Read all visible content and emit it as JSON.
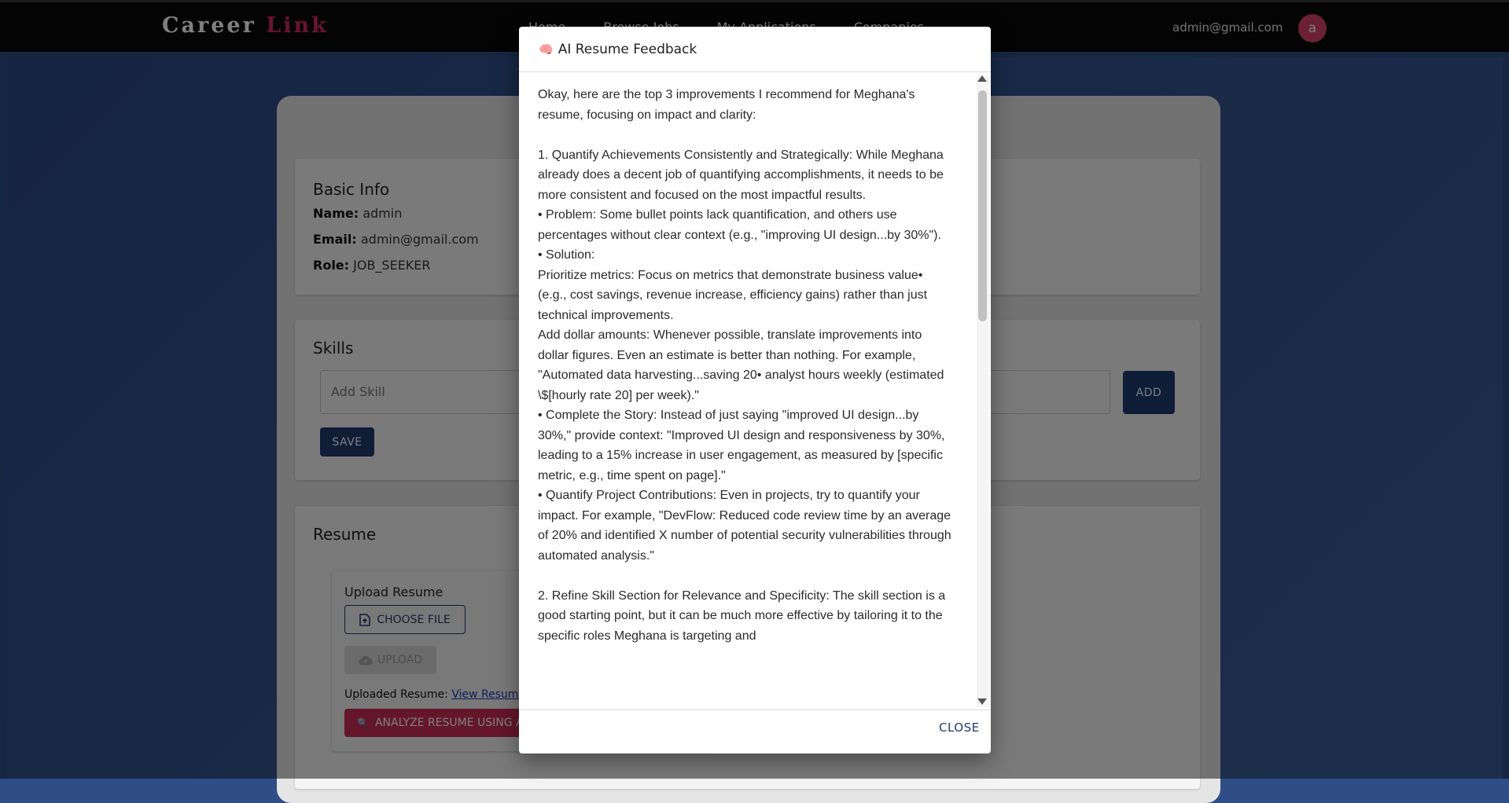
{
  "header": {
    "brand_part1": "Career",
    "brand_part2": "Link",
    "nav": [
      "Home",
      "Browse Jobs",
      "My Applications",
      "Companies"
    ],
    "user_email": "admin@gmail.com",
    "avatar_initial": "a"
  },
  "basic_info": {
    "title": "Basic Info",
    "name_label": "Name:",
    "name_value": "admin",
    "email_label": "Email:",
    "email_value": "admin@gmail.com",
    "role_label": "Role:",
    "role_value": "JOB_SEEKER"
  },
  "skills": {
    "title": "Skills",
    "placeholder": "Add Skill",
    "add_label": "ADD",
    "save_label": "SAVE"
  },
  "resume": {
    "title": "Resume",
    "upload_title": "Upload Resume",
    "choose_label": "CHOOSE FILE",
    "upload_label": "UPLOAD",
    "uploaded_prefix": "Uploaded Resume:",
    "view_link": "View Resume",
    "analyze_label": "ANALYZE RESUME USING AI"
  },
  "dialog": {
    "title": "AI Resume Feedback",
    "body": "Okay, here are the top 3 improvements I recommend for Meghana's resume, focusing on impact and clarity:\n\n1. Quantify Achievements Consistently and Strategically: While Meghana already does a decent job of quantifying accomplishments, it needs to be more consistent and focused on the most impactful results.\n• Problem: Some bullet points lack quantification, and others use percentages without clear context (e.g., \"improving UI design...by 30%\").\n• Solution:\nPrioritize metrics: Focus on metrics that demonstrate business value• (e.g., cost savings, revenue increase, efficiency gains) rather than just technical improvements.\nAdd dollar amounts: Whenever possible, translate improvements into dollar figures. Even an estimate is better than nothing. For example, \"Automated data harvesting...saving 20• analyst hours weekly (estimated \\$[hourly rate 20] per week).\"\n• Complete the Story: Instead of just saying \"improved UI design...by 30%,\" provide context: \"Improved UI design and responsiveness by 30%, leading to a 15% increase in user engagement, as measured by [specific metric, e.g., time spent on page].\"\n• Quantify Project Contributions: Even in projects, try to quantify your impact. For example, \"DevFlow: Reduced code review time by an average of 20% and identified X number of potential security vulnerabilities through automated analysis.\"\n\n2. Refine Skill Section for Relevance and Specificity: The skill section is a good starting point, but it can be much more effective by tailoring it to the specific roles Meghana is targeting and",
    "close_label": "CLOSE"
  },
  "icons": {
    "dialog_icon": "brain-icon",
    "choose_icon": "file-upload-icon",
    "upload_icon": "cloud-upload-icon",
    "analyze_icon": "search-icon"
  },
  "colors": {
    "brand_accent": "#d4265f",
    "navy": "#1f3a6e",
    "analyze": "#c92d5a"
  }
}
